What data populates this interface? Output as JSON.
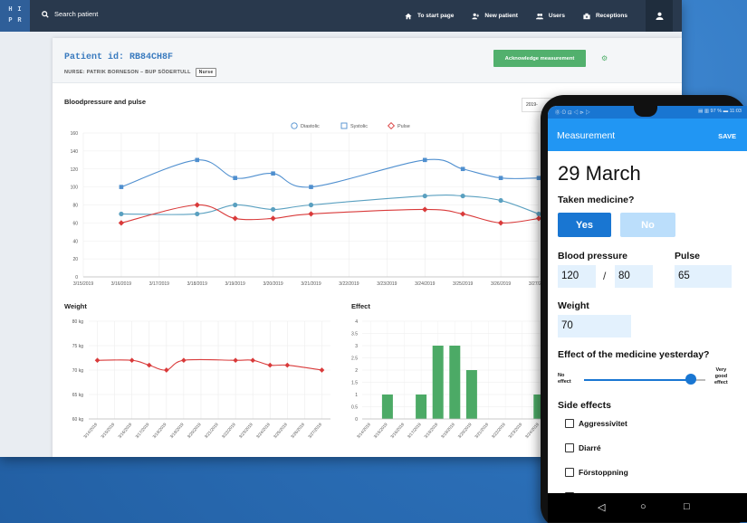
{
  "desktop": {
    "logo_letters": [
      "H",
      "I",
      "P",
      "R"
    ],
    "search_label": "Search patient",
    "nav": [
      {
        "label": "To start page",
        "icon": "home-icon"
      },
      {
        "label": "New patient",
        "icon": "add-user-icon"
      },
      {
        "label": "Users",
        "icon": "users-icon"
      },
      {
        "label": "Receptions",
        "icon": "reception-icon"
      }
    ],
    "patient_id": "Patient id: RB84CH8F",
    "nurse": "NURSE: PATRIK BORNESON – BUP SÖDERTULL",
    "nurse_tag": "Nurse",
    "ack_button": "Acknowledge measurement",
    "bp_title": "Bloodpressure and pulse",
    "date_value": "2019-",
    "weight_title": "Weight",
    "effect_title": "Effect"
  },
  "chart_data": [
    {
      "type": "line",
      "title": "Bloodpressure and pulse",
      "x": [
        "3/15/2019",
        "3/16/2019",
        "3/17/2019",
        "3/18/2019",
        "3/19/2019",
        "3/20/2019",
        "3/21/2019",
        "3/22/2019",
        "3/23/2019",
        "3/24/2019",
        "3/25/2019",
        "3/26/2019",
        "3/27/2019"
      ],
      "ylim": [
        0,
        160
      ],
      "yticks": [
        0,
        20,
        40,
        60,
        80,
        100,
        120,
        140,
        160
      ],
      "legend": "top-center",
      "series": [
        {
          "name": "Diastolic",
          "color": "#4f8fcf",
          "points": [
            [
              1,
              100
            ],
            [
              3,
              130
            ],
            [
              4,
              110
            ],
            [
              5,
              115
            ],
            [
              6,
              100
            ],
            [
              9,
              130
            ],
            [
              10,
              120
            ],
            [
              11,
              110
            ],
            [
              12,
              110
            ]
          ]
        },
        {
          "name": "Systolic",
          "color": "#5aa0c0",
          "points": [
            [
              1,
              70
            ],
            [
              3,
              70
            ],
            [
              4,
              80
            ],
            [
              5,
              75
            ],
            [
              6,
              80
            ],
            [
              9,
              90
            ],
            [
              10,
              90
            ],
            [
              11,
              85
            ],
            [
              12,
              70
            ]
          ]
        },
        {
          "name": "Pulse",
          "color": "#d93a3a",
          "points": [
            [
              1,
              60
            ],
            [
              3,
              80
            ],
            [
              4,
              65
            ],
            [
              5,
              65
            ],
            [
              6,
              70
            ],
            [
              9,
              75
            ],
            [
              10,
              70
            ],
            [
              11,
              60
            ],
            [
              12,
              65
            ]
          ]
        }
      ]
    },
    {
      "type": "line",
      "title": "Weight",
      "x": [
        "3/14/2019",
        "3/15/2019",
        "3/16/2019",
        "3/17/2019",
        "3/18/2019",
        "3/19/2019",
        "3/20/2019",
        "3/21/2019",
        "3/22/2019",
        "3/23/2019",
        "3/24/2019",
        "3/25/2019",
        "3/26/2019",
        "3/27/2019"
      ],
      "yticks": [
        "60 kg",
        "65 kg",
        "70 kg",
        "75 kg",
        "80 kg"
      ],
      "ylim": [
        60,
        80
      ],
      "series": [
        {
          "name": "",
          "color": "#d93a3a",
          "points": [
            [
              0.5,
              72
            ],
            [
              2.5,
              72
            ],
            [
              3.5,
              71
            ],
            [
              4.5,
              70
            ],
            [
              5.5,
              72
            ],
            [
              8.5,
              72
            ],
            [
              9.5,
              72
            ],
            [
              10.5,
              71
            ],
            [
              11.5,
              71
            ],
            [
              13.5,
              70
            ]
          ]
        }
      ]
    },
    {
      "type": "bar",
      "title": "Effect",
      "x": [
        "3/14/2019",
        "3/15/2019",
        "3/16/2019",
        "3/17/2019",
        "3/18/2019",
        "3/19/2019",
        "3/20/2019",
        "3/21/2019",
        "3/22/2019",
        "3/23/2019",
        "3/24/2019"
      ],
      "yticks": [
        0,
        0.5,
        1,
        1.5,
        2,
        2.5,
        3,
        3.5,
        4
      ],
      "ylim": [
        0,
        4
      ],
      "color": "#4caa66",
      "values": [
        0,
        1,
        0,
        1,
        3,
        3,
        2,
        0,
        0,
        0,
        1
      ]
    }
  ],
  "phone": {
    "status_left": "⓪ ⊙ ⊡ ◁ ⊳ ▷",
    "status_right": "▤ ▥ 97 % ▬ 11:03",
    "title": "Measurement",
    "save": "SAVE",
    "date": "29 March",
    "taken_medicine_label": "Taken medicine?",
    "yes": "Yes",
    "no": "No",
    "bp_label": "Blood pressure",
    "pulse_label": "Pulse",
    "systolic": "120",
    "slash": "/",
    "diastolic": "80",
    "pulse": "65",
    "weight_label": "Weight",
    "weight": "70",
    "effect_label": "Effect of the medicine yesterday?",
    "no_effect_1": "No",
    "no_effect_2": "effect",
    "very_good_1": "Very",
    "very_good_2": "good",
    "very_good_3": "effect",
    "effect_fraction": 0.88,
    "side_effects_label": "Side effects",
    "side_effects": [
      "Aggressivitet",
      "Diarré",
      "Förstoppning"
    ]
  }
}
